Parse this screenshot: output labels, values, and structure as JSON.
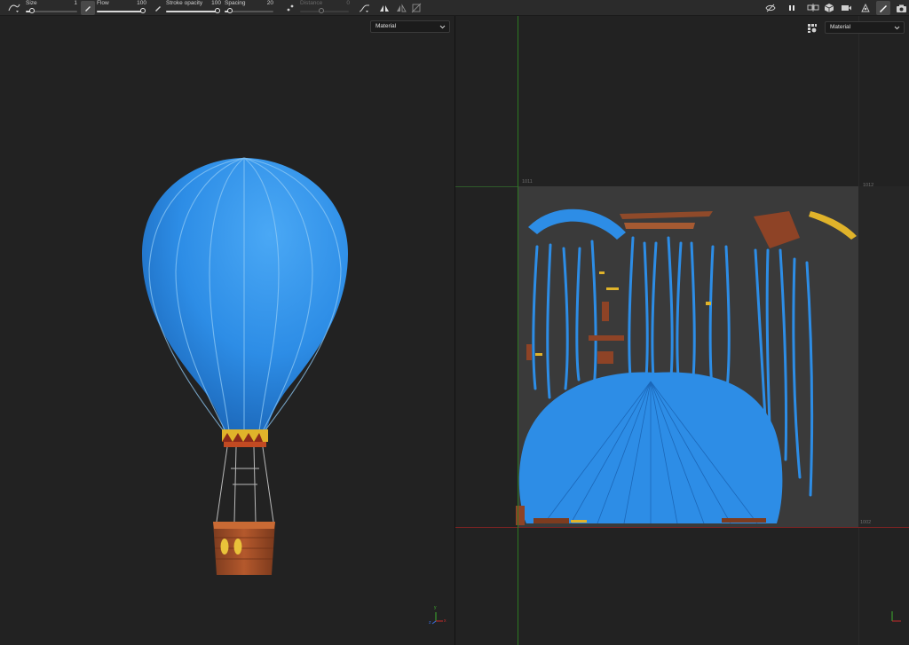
{
  "toolbar": {
    "size": {
      "label": "Size",
      "value": "1"
    },
    "flow": {
      "label": "Flow",
      "value": "100"
    },
    "stroke_opacity": {
      "label": "Stroke opacity",
      "value": "100"
    },
    "spacing": {
      "label": "Spacing",
      "value": "20"
    },
    "distance": {
      "label": "Distance",
      "value": "0"
    }
  },
  "viewport_3d": {
    "channel_select": "Material"
  },
  "viewport_2d": {
    "channel_select": "Material",
    "udim_tiles": {
      "top_left": "1011",
      "top_right": "1012",
      "bottom_left": "1001",
      "bottom_right": "1002"
    }
  },
  "axis_labels": {
    "x": "x",
    "y": "y",
    "z": "z"
  },
  "colors": {
    "balloon_blue": "#2d8de6",
    "x_axis": "#c42b2b",
    "y_axis": "#3fae2f",
    "z_axis": "#3b6fe0",
    "basket_brown": "#9b4a26",
    "gold": "#e0b32a"
  },
  "icons": [
    "brush-stroke-icon",
    "pen-tip-icon",
    "eraser-icon",
    "pattern-icon",
    "curve-icon",
    "symmetry-icon",
    "symmetry-off-icon",
    "transform-icon",
    "visibility-off-icon",
    "pause-icon",
    "camera-views-icon",
    "cube-icon",
    "video-icon",
    "lights-icon",
    "paint-brush-icon",
    "screenshot-icon",
    "view-options-icon"
  ]
}
